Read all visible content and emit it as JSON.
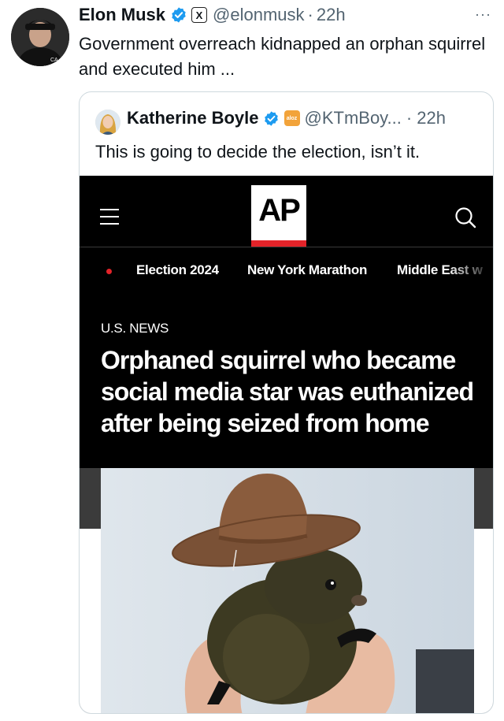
{
  "tweet": {
    "author_name": "Elon Musk",
    "handle": "@elonmusk",
    "separator": "·",
    "time": "22h",
    "more": "···",
    "text": "Government overreach kidnapped an orphan squirrel and executed him ...",
    "affiliate_badge": "X",
    "verified_color": "#1d9bf0"
  },
  "quote": {
    "author_name": "Katherine Boyle",
    "affiliate_badge": "aloz",
    "handle": "@KTmBoy...",
    "separator": "·",
    "time": "22h",
    "text": "This is going to decide the election, isn’t it."
  },
  "ap": {
    "logo": "AP",
    "nav": [
      "Election 2024",
      "New York Marathon",
      "Middle East w"
    ],
    "section": "U.S. NEWS",
    "headline": "Orphaned squirrel who became social media star was euthanized after being seized from home",
    "accent": "#e32329",
    "icons": {
      "menu": "hamburger-icon",
      "search": "search-icon"
    }
  }
}
